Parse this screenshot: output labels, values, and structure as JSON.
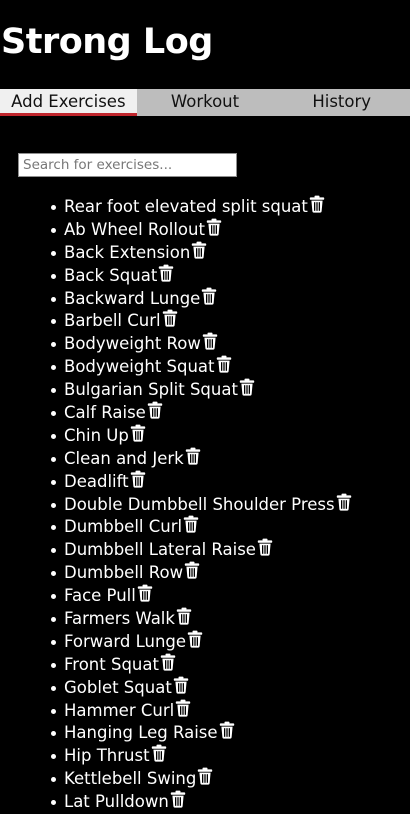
{
  "app": {
    "title": "Strong Log"
  },
  "tabs": [
    {
      "label": "Add Exercises",
      "active": true
    },
    {
      "label": "Workout",
      "active": false
    },
    {
      "label": "History",
      "active": false
    }
  ],
  "search": {
    "placeholder": "Search for exercises...",
    "value": ""
  },
  "exercises": [
    "Rear foot elevated split squat",
    "Ab Wheel Rollout",
    "Back Extension",
    "Back Squat",
    "Backward Lunge",
    "Barbell Curl",
    "Bodyweight Row",
    "Bodyweight Squat",
    "Bulgarian Split Squat",
    "Calf Raise",
    "Chin Up",
    "Clean and Jerk",
    "Deadlift",
    "Double Dumbbell Shoulder Press",
    "Dumbbell Curl",
    "Dumbbell Lateral Raise",
    "Dumbbell Row",
    "Face Pull",
    "Farmers Walk",
    "Forward Lunge",
    "Front Squat",
    "Goblet Squat",
    "Hammer Curl",
    "Hanging Leg Raise",
    "Hip Thrust",
    "Kettlebell Swing",
    "Lat Pulldown"
  ],
  "icons": {
    "delete": "trash-icon"
  },
  "colors": {
    "background": "#000000",
    "tabbar": "#bdbdbd",
    "active_tab": "#f0f0f0",
    "active_indicator": "#c0262d",
    "text": "#ffffff"
  }
}
